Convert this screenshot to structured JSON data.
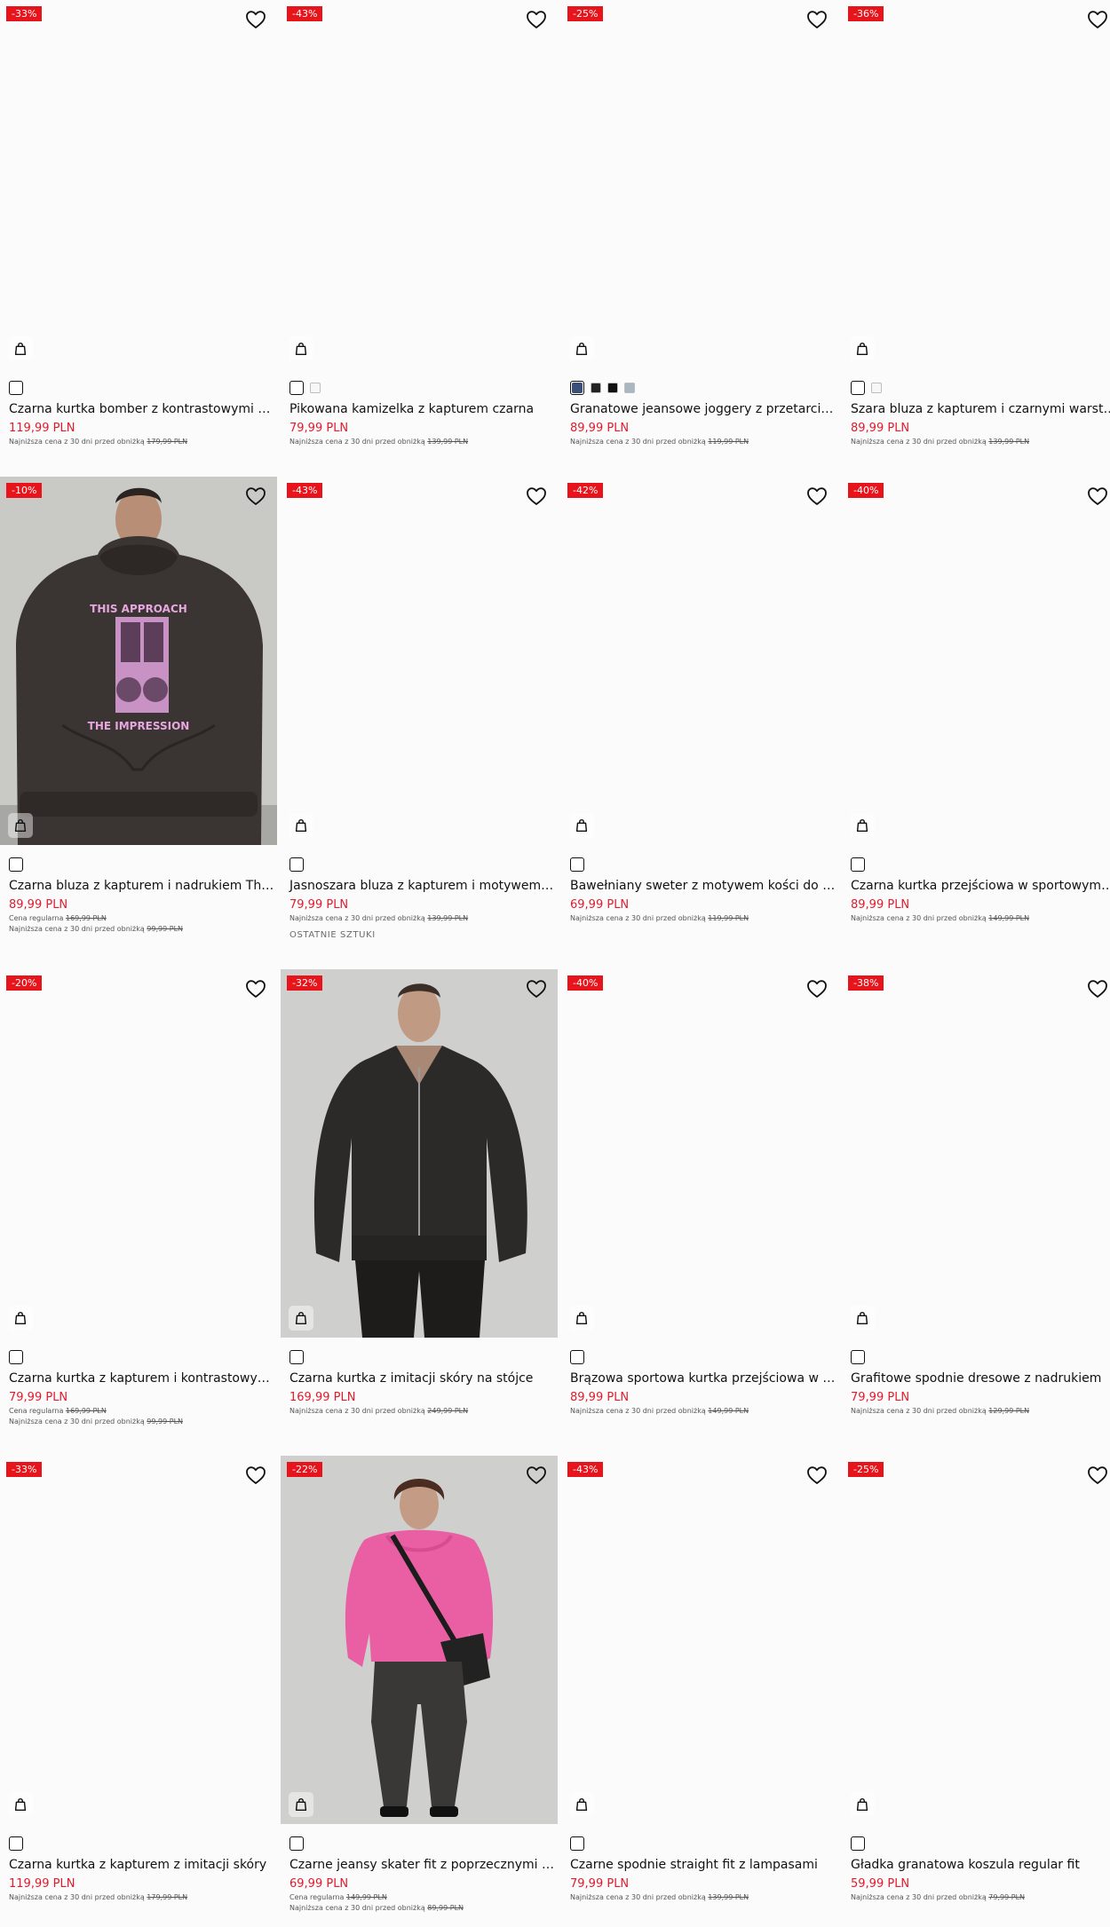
{
  "products": [
    {
      "discount": "-33%",
      "swatches": [
        "#ffffff"
      ],
      "selected": 0,
      "title": "Czarna kurtka bomber z kontrastowymi prze...",
      "price": "119,99 PLN",
      "regular": null,
      "lowest_label": "Najniższa cena z 30 dni przed obniżką",
      "lowest": "179,99 PLN",
      "tag": null,
      "image": "blank"
    },
    {
      "discount": "-43%",
      "swatches": [
        "#ffffff",
        "#f7f7f7"
      ],
      "selected": 0,
      "title": "Pikowana kamizelka z kapturem czarna",
      "price": "79,99 PLN",
      "regular": null,
      "lowest_label": "Najniższa cena z 30 dni przed obniżką",
      "lowest": "139,99 PLN",
      "tag": null,
      "image": "blank"
    },
    {
      "discount": "-25%",
      "swatches": [
        "#3c4f78",
        "#222222",
        "#111111",
        "#a8b7c2"
      ],
      "selected": 0,
      "title": "Granatowe jeansowe joggery z przetarciami",
      "price": "89,99 PLN",
      "regular": null,
      "lowest_label": "Najniższa cena z 30 dni przed obniżką",
      "lowest": "119,99 PLN",
      "tag": null,
      "image": "blank"
    },
    {
      "discount": "-36%",
      "swatches": [
        "#ffffff",
        "#f7f7f7"
      ],
      "selected": 0,
      "title": "Szara bluza z kapturem i czarnymi warstwow...",
      "price": "89,99 PLN",
      "regular": null,
      "lowest_label": "Najniższa cena z 30 dni przed obniżką",
      "lowest": "139,99 PLN",
      "tag": null,
      "image": "blank"
    },
    {
      "discount": "-10%",
      "swatches": [
        "#ffffff"
      ],
      "selected": 0,
      "title": "Czarna bluza z kapturem i nadrukiem This A...",
      "price": "89,99 PLN",
      "regular_label": "Cena regularna",
      "regular": "169,99 PLN",
      "lowest_label": "Najniższa cena z 30 dni przed obniżką",
      "lowest": "99,99 PLN",
      "tag": null,
      "image": "hoodie",
      "print_top": "THIS APPROACH",
      "print_bottom": "THE IMPRESSION"
    },
    {
      "discount": "-43%",
      "swatches": [
        "#ffffff"
      ],
      "selected": 0,
      "title": "Jasnoszara bluza z kapturem i motywem paj...",
      "price": "79,99 PLN",
      "regular": null,
      "lowest_label": "Najniższa cena z 30 dni przed obniżką",
      "lowest": "139,99 PLN",
      "tag": "OSTATNIE SZTUKI",
      "image": "blank"
    },
    {
      "discount": "-42%",
      "swatches": [
        "#ffffff"
      ],
      "selected": 0,
      "title": "Bawełniany sweter z motywem kości do gry ...",
      "price": "69,99 PLN",
      "regular": null,
      "lowest_label": "Najniższa cena z 30 dni przed obniżką",
      "lowest": "119,99 PLN",
      "tag": null,
      "image": "blank"
    },
    {
      "discount": "-40%",
      "swatches": [
        "#ffffff"
      ],
      "selected": 0,
      "title": "Czarna kurtka przejściowa w sportowym stylu",
      "price": "89,99 PLN",
      "regular": null,
      "lowest_label": "Najniższa cena z 30 dni przed obniżką",
      "lowest": "149,99 PLN",
      "tag": null,
      "image": "blank"
    },
    {
      "discount": "-20%",
      "swatches": [
        "#ffffff"
      ],
      "selected": 0,
      "title": "Czarna kurtka z kapturem i kontrastowymi ...",
      "price": "79,99 PLN",
      "regular_label": "Cena regularna",
      "regular": "169,99 PLN",
      "lowest_label": "Najniższa cena z 30 dni przed obniżką",
      "lowest": "99,99 PLN",
      "tag": null,
      "image": "blank"
    },
    {
      "discount": "-32%",
      "swatches": [
        "#ffffff"
      ],
      "selected": 0,
      "title": "Czarna kurtka z imitacji skóry na stójce",
      "price": "169,99 PLN",
      "regular": null,
      "lowest_label": "Najniższa cena z 30 dni przed obniżką",
      "lowest": "249,99 PLN",
      "tag": null,
      "image": "jacket"
    },
    {
      "discount": "-40%",
      "swatches": [
        "#ffffff"
      ],
      "selected": 0,
      "title": "Brązowa sportowa kurtka przejściowa w styl...",
      "price": "89,99 PLN",
      "regular": null,
      "lowest_label": "Najniższa cena z 30 dni przed obniżką",
      "lowest": "149,99 PLN",
      "tag": null,
      "image": "blank"
    },
    {
      "discount": "-38%",
      "swatches": [
        "#ffffff"
      ],
      "selected": 0,
      "title": "Grafitowe spodnie dresowe z nadrukiem",
      "price": "79,99 PLN",
      "regular": null,
      "lowest_label": "Najniższa cena z 30 dni przed obniżką",
      "lowest": "129,99 PLN",
      "tag": null,
      "image": "blank"
    },
    {
      "discount": "-33%",
      "swatches": [
        "#ffffff"
      ],
      "selected": 0,
      "title": "Czarna kurtka z kapturem z imitacji skóry",
      "price": "119,99 PLN",
      "regular": null,
      "lowest_label": "Najniższa cena z 30 dni przed obniżką",
      "lowest": "179,99 PLN",
      "tag": null,
      "image": "blank"
    },
    {
      "discount": "-22%",
      "swatches": [
        "#ffffff"
      ],
      "selected": 0,
      "title": "Czarne jeansy skater fit z poprzecznymi prze...",
      "price": "69,99 PLN",
      "regular_label": "Cena regularna",
      "regular": "149,99 PLN",
      "lowest_label": "Najniższa cena z 30 dni przed obniżką",
      "lowest": "89,99 PLN",
      "tag": null,
      "image": "pink"
    },
    {
      "discount": "-43%",
      "swatches": [
        "#ffffff"
      ],
      "selected": 0,
      "title": "Czarne spodnie straight fit z lampasami",
      "price": "79,99 PLN",
      "regular": null,
      "lowest_label": "Najniższa cena z 30 dni przed obniżką",
      "lowest": "139,99 PLN",
      "tag": null,
      "image": "blank"
    },
    {
      "discount": "-25%",
      "swatches": [
        "#ffffff"
      ],
      "selected": 0,
      "title": "Gładka granatowa koszula regular fit",
      "price": "59,99 PLN",
      "regular": null,
      "lowest_label": "Najniższa cena z 30 dni przed obniżką",
      "lowest": "79,99 PLN",
      "tag": null,
      "image": "blank"
    }
  ],
  "icons": {
    "wishlist": "heart-icon",
    "add_to_cart": "shopping-bag-icon"
  },
  "colors": {
    "badge": "#e8141c",
    "price": "#e21b2c",
    "background": "#fbfbfb"
  }
}
